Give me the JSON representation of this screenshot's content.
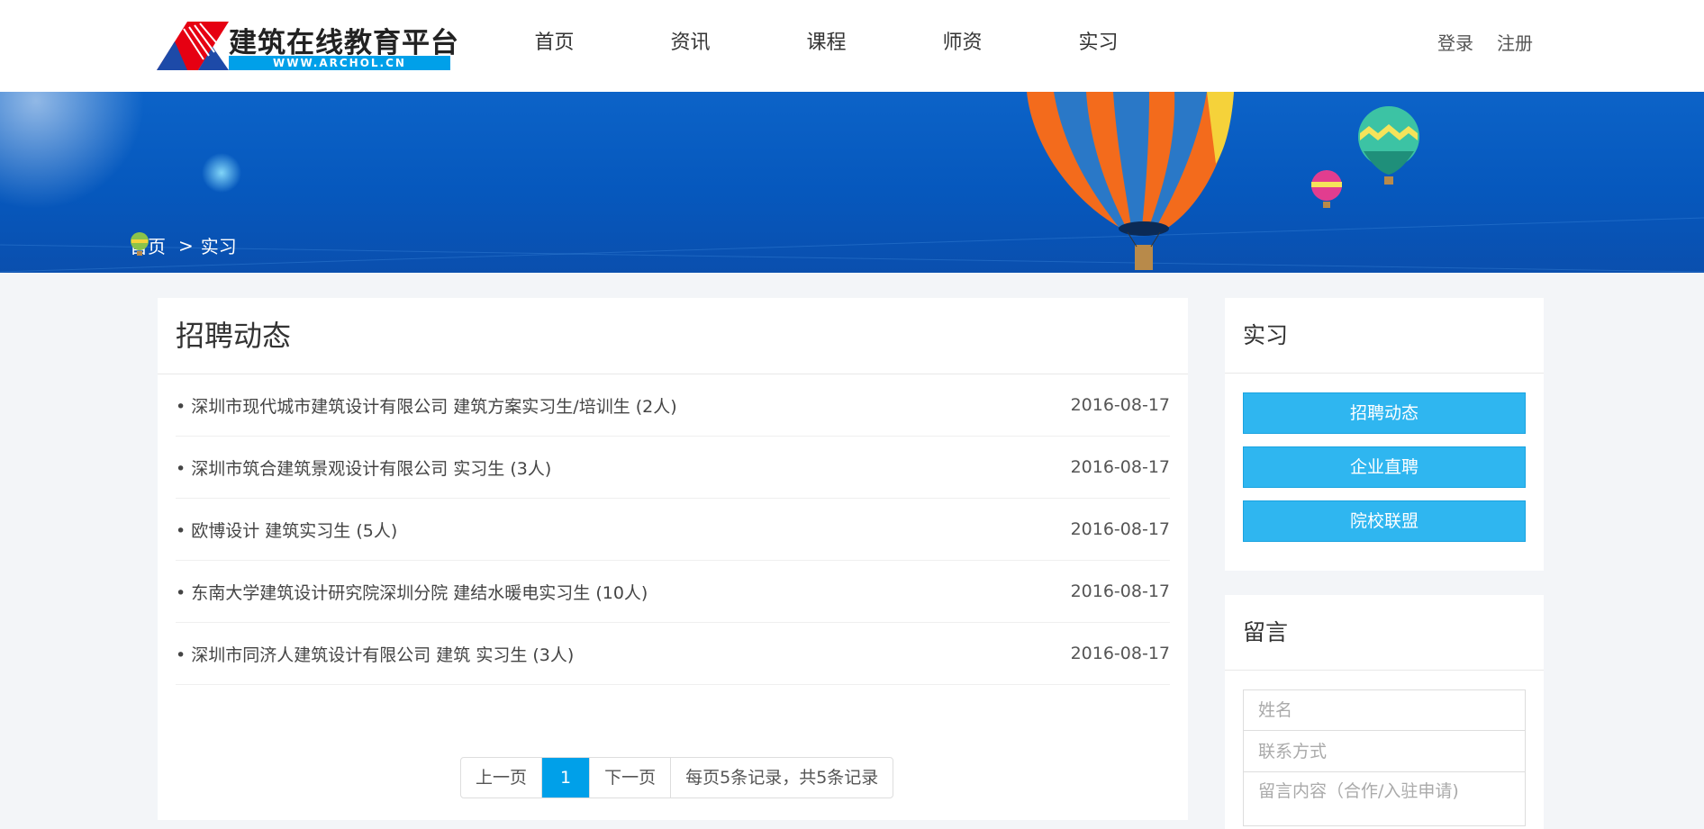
{
  "logo": {
    "title": "建筑在线教育平台",
    "url_text": "WWW.ARCHOL.CN"
  },
  "nav": {
    "items": [
      "首页",
      "资讯",
      "课程",
      "师资",
      "实习"
    ]
  },
  "auth": {
    "login": "登录",
    "register": "注册"
  },
  "breadcrumb": {
    "home": "首页",
    "separator": ">",
    "current": "实习"
  },
  "main": {
    "title": "招聘动态",
    "items": [
      {
        "title": "深圳市现代城市建筑设计有限公司 建筑方案实习生/培训生 (2人)",
        "date": "2016-08-17"
      },
      {
        "title": "深圳市筑合建筑景观设计有限公司 实习生 (3人)",
        "date": "2016-08-17"
      },
      {
        "title": "欧博设计 建筑实习生 (5人)",
        "date": "2016-08-17"
      },
      {
        "title": "东南大学建筑设计研究院深圳分院 建结水暖电实习生 (10人)",
        "date": "2016-08-17"
      },
      {
        "title": "深圳市同济人建筑设计有限公司 建筑 实习生 (3人)",
        "date": "2016-08-17"
      }
    ]
  },
  "pager": {
    "prev": "上一页",
    "current": "1",
    "next": "下一页",
    "summary": "每页5条记录，共5条记录"
  },
  "sidebar": {
    "section_title": "实习",
    "buttons": [
      "招聘动态",
      "企业直聘",
      "院校联盟"
    ],
    "message_title": "留言",
    "name_placeholder": "姓名",
    "contact_placeholder": "联系方式",
    "content_placeholder": "留言内容（合作/入驻申请)"
  },
  "colors": {
    "accent": "#00a0e9",
    "button": "#2fb6f0",
    "banner": "#0658bd"
  }
}
